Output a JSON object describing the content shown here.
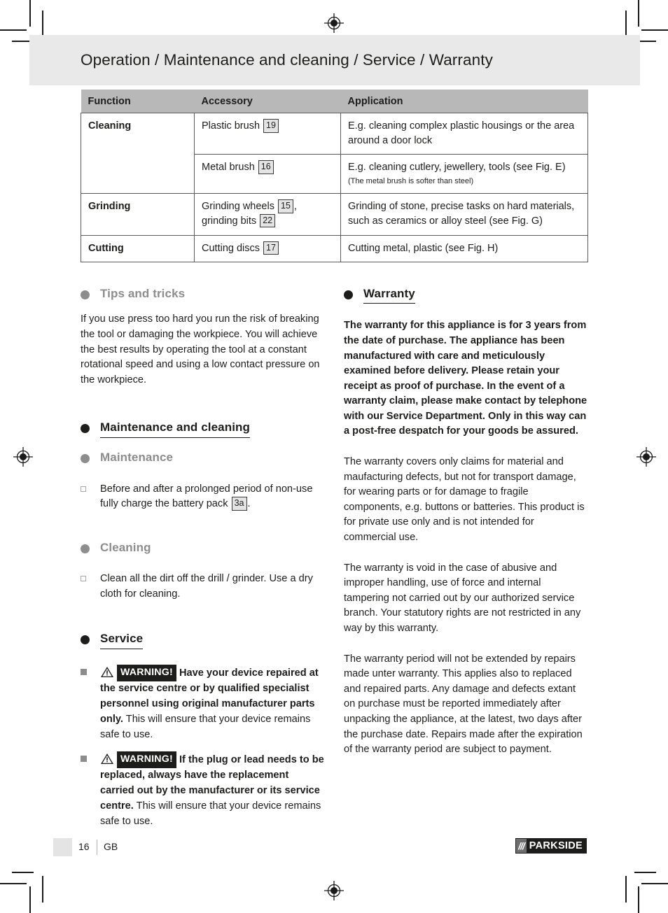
{
  "header": {
    "title": "Operation / Maintenance and cleaning / Service / Warranty"
  },
  "table": {
    "columns": [
      "Function",
      "Accessory",
      "Application"
    ],
    "rows": [
      {
        "function": "Cleaning",
        "accessory_pre": "Plastic brush",
        "accessory_ref": "19",
        "accessory_post": "",
        "application": "E.g. cleaning complex plastic housings or the area around a door lock",
        "note": ""
      },
      {
        "function": "",
        "accessory_pre": "Metal brush",
        "accessory_ref": "16",
        "accessory_post": "",
        "application": "E.g. cleaning cutlery, jewellery, tools (see Fig. E)",
        "note": "(The metal brush is softer than steel)"
      },
      {
        "function": "Grinding",
        "accessory_pre": "Grinding wheels",
        "accessory_ref": "15",
        "accessory_post": ", grinding bits",
        "accessory_ref2": "22",
        "application": "Grinding of stone, precise tasks on hard materials, such as ceramics or alloy steel (see Fig. G)",
        "note": ""
      },
      {
        "function": "Cutting",
        "accessory_pre": "Cutting discs",
        "accessory_ref": "17",
        "accessory_post": "",
        "application": "Cutting metal, plastic (see Fig. H)",
        "note": ""
      }
    ]
  },
  "left_column": {
    "tips_heading": "Tips and tricks",
    "tips_paragraph": "If you use press too hard you run the risk of breaking the tool or damaging the workpiece. You will achieve the best results by operating the tool at a constant rotational speed and using a low contact pressure on the workpiece.",
    "maintenance_cleaning_heading": "Maintenance and cleaning",
    "maintenance_heading": "Maintenance",
    "maintenance_item_pre": "Before and after a prolonged period of non-use fully charge the battery pack",
    "maintenance_item_ref": "3a",
    "maintenance_item_post": ".",
    "cleaning_heading": "Cleaning",
    "cleaning_item": "Clean all the dirt off the drill / grinder. Use a dry cloth for cleaning.",
    "service_heading": "Service",
    "warning_label": "WARNING!",
    "warnings": [
      {
        "bold": "Have your device repaired at the service centre or by qualified specialist personnel using original manufacturer parts only.",
        "rest": " This will ensure that your device remains safe to use."
      },
      {
        "bold": "If the plug or lead needs to be replaced, always have the replacement carried out by the manufacturer or its service centre.",
        "rest": " This will ensure that your device remains safe to use."
      }
    ]
  },
  "right_column": {
    "warranty_heading": "Warranty",
    "warranty_bold": "The warranty for this appliance is for 3 years from the date of purchase. The appliance has been manufactured with care and meticulously examined before delivery. Please retain your receipt as proof of purchase. In the event of a warranty claim, please make contact by telephone with our Service Department. Only in this way can a post-free despatch for your goods be assured.",
    "paragraphs": [
      "The warranty covers only claims for material and maufacturing defects, but not for transport damage, for wearing parts or for damage to fragile components, e.g. buttons or batteries. This product is for private use only and is not intended for commercial use.",
      "The warranty is void in the case of abusive and improper handling, use of force and internal tampering not carried out by our authorized service branch. Your statutory rights are not restricted in any way by this warranty.",
      "The warranty period will not be extended by repairs made unter warranty. This applies also to replaced and repaired parts. Any damage and defects extant on purchase must be reported immediately after unpacking the appliance, at the latest, two days after the purchase date. Repairs made after the expiration of the warranty period are subject to payment."
    ]
  },
  "footer": {
    "page_number": "16",
    "language": "GB",
    "logo_slashes": "///",
    "logo_name": "PARKSIDE"
  }
}
